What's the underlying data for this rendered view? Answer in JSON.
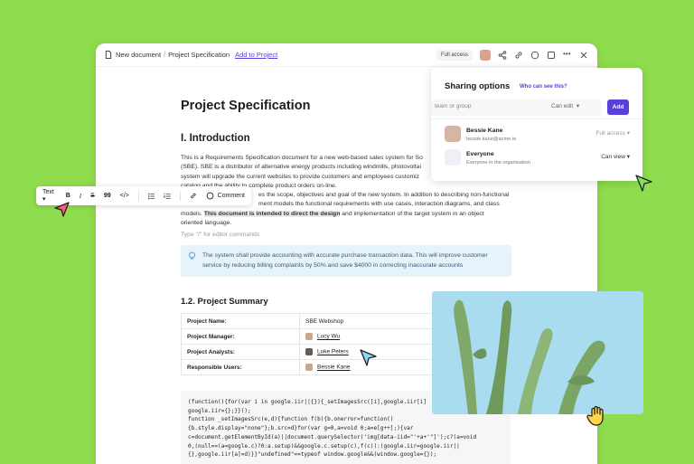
{
  "header": {
    "doc_name": "New document",
    "page_name": "Project Specification",
    "add_link": "Add to Project",
    "access": "Full access"
  },
  "doc": {
    "title": "Project Specification",
    "intro_heading": "I. Introduction",
    "intro_p1": "This is a Requirements Specification document for a new web-based sales system for So",
    "intro_p2": "(SBE). SBE is a distributor of alternative energy products including windmills, photovoltai",
    "intro_p3": "system will upgrade the current websites to provide customers and employees customiz",
    "intro_p4": "catalog and the ability to complete product orders on-line.",
    "intro_p5": "es the scope, objectives and goal of the new system. In addition to describing non-functional",
    "intro_p6": "ment models the functional requirements with use cases, interaction diagrams, and class",
    "intro_p7a": "models. ",
    "intro_p7b": "This document is intended to direct the design",
    "intro_p7c": " and implementation of the target system in an object",
    "intro_p8": "oriented language.",
    "placeholder": "Type \"/\" for editor commands",
    "callout_l1": "The system shall provide accounting with accurate purchase transaction data. This will improve customer",
    "callout_l2": "service by reducing billing complaints by 50% and save $4000 in correcting inaccurate accounts",
    "summary_heading": "1.2. Project Summary",
    "summary": [
      {
        "k": "Project Name:",
        "v": "SBE Webshop"
      },
      {
        "k": "Project Manager:",
        "v": "Lucy Wu"
      },
      {
        "k": "Project Analysts:",
        "v": "Luke Peters"
      },
      {
        "k": "Responsible Users:",
        "v": "Bessie Kane"
      }
    ],
    "code": "(function(){for(var i in google.iir||{}){_setImagesSrc([i],google.iir[i]\ngoogle.iir={};}}();\nfunction _setImagesSrc(e,d){function f(b){b.onerror=function()\n{b.style.display=\"none\"};b.src=d}for(var g=0,a=void 0;a=e[g++];){var\nc=document.getElementById(a)||document.querySelector('img[data-iid=\"'+a+'\"]');c?(a=void\n0,(null==(a=google.c)?0:a.setup)&&google.c.setup(c),f(c)):(google.iir=google.iir||\n{},google.iir[a]=d)}}\"undefined\"==typeof window.google&&(window.google={});"
  },
  "toolbar": {
    "text_style": "Text",
    "bold": "B",
    "italic": "I",
    "strike": "S",
    "quote": "99",
    "code": "</>",
    "comment": "Comment"
  },
  "sharing": {
    "title": "Sharing options",
    "who": "Who can see this?",
    "input_placeholder": "team or group",
    "permission": "Can edit",
    "add": "Add",
    "user_name": "Bessie Kane",
    "user_email": "bessie.kane@acme.io",
    "user_role": "Full access",
    "everyone_label": "Everyone",
    "everyone_sub": "Everyone in the organisation",
    "everyone_role": "Can view"
  },
  "colors": {
    "background": "#8fdd4e",
    "accent": "#5a3fd8",
    "callout": "#e6f3fb"
  }
}
